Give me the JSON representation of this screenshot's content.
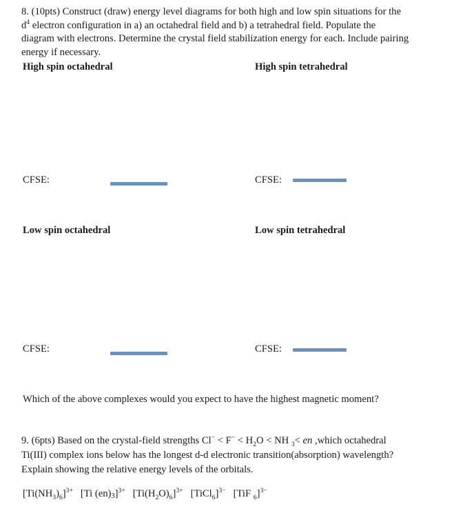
{
  "document": {
    "type": "chemistry-worksheet-scan",
    "background_color": "#ffffff",
    "text_color": "#1a1a1a",
    "rule_color": "#6b92bd"
  },
  "question8": {
    "line1": "8. (10pts)  Construct (draw) energy level diagrams for both high and low spin situations for the",
    "line2_prefix": "d",
    "line2_sup": "4",
    "line2_rest": " electron configuration in a) an octahedral field and b) a tetrahedral field.  Populate the",
    "line3": "diagram with electrons. Determine the crystal field stabilization energy for each. Include pairing",
    "line4": "energy if necessary.",
    "headings": {
      "high_spin_octahedral": "High spin octahedral",
      "high_spin_tetrahedral": "High spin tetrahedral",
      "low_spin_octahedral": "Low spin octahedral",
      "low_spin_tetrahedral": "Low spin tetrahedral"
    },
    "cfse_label": "CFSE:",
    "cfse_answers": {
      "high_spin_octahedral": "",
      "high_spin_tetrahedral": "",
      "low_spin_octahedral": "",
      "low_spin_tetrahedral": ""
    },
    "magnetic_moment_question": "Which of the above complexes would you expect to have the highest magnetic moment?"
  },
  "question9": {
    "line1_part1": "9. (6pts) Based on the crystal-field strengths  Cl",
    "line1_sup1": "−",
    "line1_part2": " < F",
    "line1_sup2": "−",
    "line1_part3": " < H",
    "line1_sub1": "2",
    "line1_part4": "O < NH ",
    "line1_sub2": "3",
    "line1_part5": "< ",
    "line1_italic": "en",
    "line1_part6": " ,which octahedral",
    "line2": "Ti(III) complex ions below has the longest d-d electronic transition(absorption) wavelength?",
    "line3": "Explain showing the relative energy levels of the orbitals.",
    "ions": [
      {
        "id": "ti-nh3-6",
        "segments": [
          {
            "t": "[Ti(NH",
            "k": "n"
          },
          {
            "t": "3",
            "k": "sub"
          },
          {
            "t": ")",
            "k": "n"
          },
          {
            "t": "6",
            "k": "sub"
          },
          {
            "t": "]",
            "k": "n"
          },
          {
            "t": "3+",
            "k": "sup"
          }
        ]
      },
      {
        "id": "ti-en-3",
        "segments": [
          {
            "t": "[Ti (en)",
            "k": "n"
          },
          {
            "t": "3",
            "k": "subbase"
          },
          {
            "t": "]",
            "k": "n"
          },
          {
            "t": "3+",
            "k": "sup"
          }
        ]
      },
      {
        "id": "ti-h2o-6",
        "segments": [
          {
            "t": "[Ti(H",
            "k": "n"
          },
          {
            "t": "2",
            "k": "sub"
          },
          {
            "t": "O)",
            "k": "n"
          },
          {
            "t": "6",
            "k": "sub"
          },
          {
            "t": "]",
            "k": "n"
          },
          {
            "t": "3+",
            "k": "sup"
          }
        ]
      },
      {
        "id": "ticl6",
        "segments": [
          {
            "t": "[TiCl",
            "k": "n"
          },
          {
            "t": "6",
            "k": "sub"
          },
          {
            "t": "]",
            "k": "n"
          },
          {
            "t": "3−",
            "k": "sup"
          }
        ]
      },
      {
        "id": "tif6",
        "segments": [
          {
            "t": "[TiF ",
            "k": "n"
          },
          {
            "t": "6",
            "k": "sub"
          },
          {
            "t": "]",
            "k": "n"
          },
          {
            "t": "3−",
            "k": "sup"
          }
        ]
      }
    ]
  }
}
